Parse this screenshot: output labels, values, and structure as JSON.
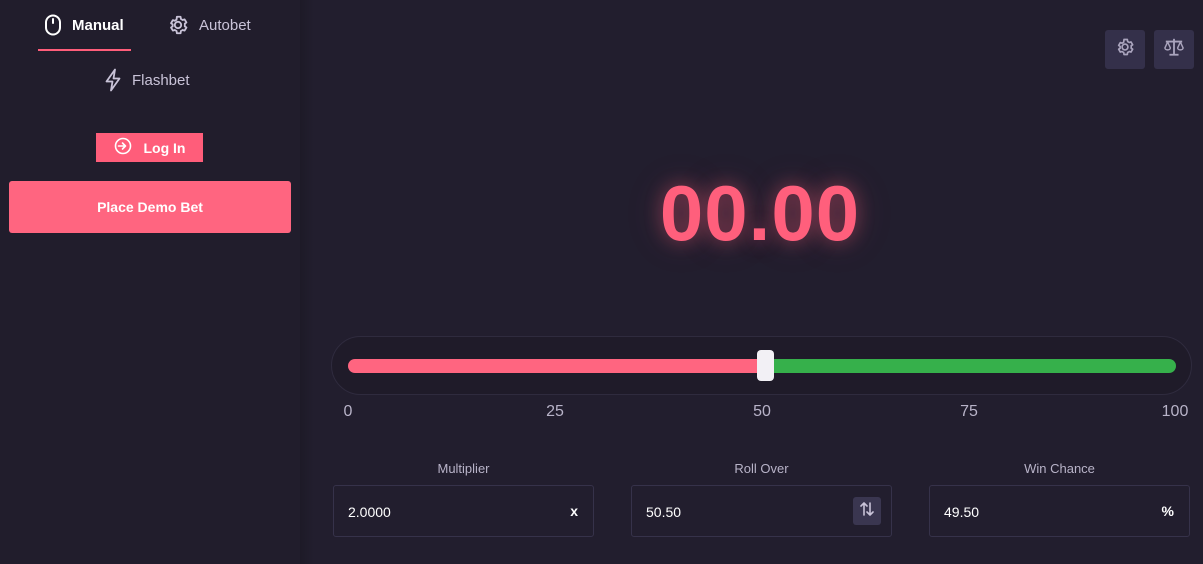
{
  "sidebar": {
    "tabs": [
      {
        "label": "Manual",
        "icon": "mouse-icon"
      },
      {
        "label": "Autobet",
        "icon": "gear-icon"
      },
      {
        "label": "Flashbet",
        "icon": "lightning-icon"
      }
    ],
    "login_label": "Log In",
    "bet_label": "Place Demo Bet"
  },
  "toolbar": {
    "icons": [
      "gear-icon",
      "scale-icon"
    ]
  },
  "result": {
    "value": "00.00"
  },
  "slider": {
    "ticks": [
      "0",
      "25",
      "50",
      "75",
      "100"
    ],
    "value": 50.5,
    "min": 0,
    "max": 100
  },
  "fields": {
    "multiplier": {
      "label": "Multiplier",
      "value": "2.0000",
      "suffix": "x"
    },
    "roll_over": {
      "label": "Roll Over",
      "value": "50.50"
    },
    "win_chance": {
      "label": "Win Chance",
      "value": "49.50",
      "suffix": "%"
    }
  },
  "colors": {
    "accent": "#ff5d7a",
    "win": "#36b04b",
    "background": "#221e2e"
  }
}
